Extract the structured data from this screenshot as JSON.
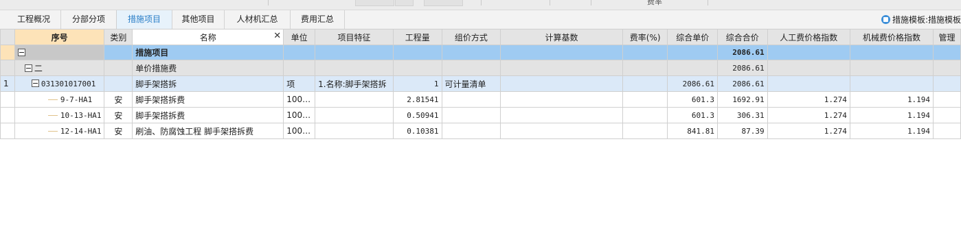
{
  "window": {
    "title_fragment": "费率"
  },
  "tabs": [
    {
      "label": "工程概况",
      "active": false
    },
    {
      "label": "分部分项",
      "active": false
    },
    {
      "label": "措施项目",
      "active": true
    },
    {
      "label": "其他项目",
      "active": false
    },
    {
      "label": "人材机汇总",
      "active": false
    },
    {
      "label": "费用汇总",
      "active": false
    }
  ],
  "template": {
    "icon": "template-icon",
    "label": "措施模板:措施模板"
  },
  "columns": [
    "序号",
    "类别",
    "名称",
    "单位",
    "项目特征",
    "工程量",
    "组价方式",
    "计算基数",
    "费率(%)",
    "综合单价",
    "综合合价",
    "人工费价格指数",
    "机械费价格指数",
    "管理"
  ],
  "rows": [
    {
      "rn": "",
      "seq": "",
      "cat": "",
      "name": "措施项目",
      "unit": "",
      "feature": "",
      "qty": "",
      "method": "",
      "base": "",
      "rate": "",
      "uprice": "",
      "total": "2086.61",
      "labor_idx": "",
      "mach_idx": "",
      "mgmt": ""
    },
    {
      "rn": "",
      "seq": "二",
      "cat": "",
      "name": "单价措施费",
      "unit": "",
      "feature": "",
      "qty": "",
      "method": "",
      "base": "",
      "rate": "",
      "uprice": "",
      "total": "2086.61",
      "labor_idx": "",
      "mach_idx": "",
      "mgmt": ""
    },
    {
      "rn": "1",
      "seq": "031301017001",
      "cat": "",
      "name": "脚手架搭拆",
      "unit": "项",
      "feature": "1.名称:脚手架搭拆",
      "qty": "1",
      "method": "可计量清单",
      "base": "",
      "rate": "",
      "uprice": "2086.61",
      "total": "2086.61",
      "labor_idx": "",
      "mach_idx": "",
      "mgmt": ""
    },
    {
      "rn": "",
      "seq": "9-7-HA1",
      "cat": "安",
      "name": "脚手架搭拆费",
      "unit": "100…",
      "feature": "",
      "qty": "2.81541",
      "method": "",
      "base": "",
      "rate": "",
      "uprice": "601.3",
      "total": "1692.91",
      "labor_idx": "1.274",
      "mach_idx": "1.194",
      "mgmt": ""
    },
    {
      "rn": "",
      "seq": "10-13-HA1",
      "cat": "安",
      "name": "脚手架搭拆费",
      "unit": "100…",
      "feature": "",
      "qty": "0.50941",
      "method": "",
      "base": "",
      "rate": "",
      "uprice": "601.3",
      "total": "306.31",
      "labor_idx": "1.274",
      "mach_idx": "1.194",
      "mgmt": ""
    },
    {
      "rn": "",
      "seq": "12-14-HA1",
      "cat": "安",
      "name": "刷油、防腐蚀工程 脚手架搭拆费",
      "unit": "100…",
      "feature": "",
      "qty": "0.10381",
      "method": "",
      "base": "",
      "rate": "",
      "uprice": "841.81",
      "total": "87.39",
      "labor_idx": "1.274",
      "mach_idx": "1.194",
      "mgmt": ""
    }
  ]
}
